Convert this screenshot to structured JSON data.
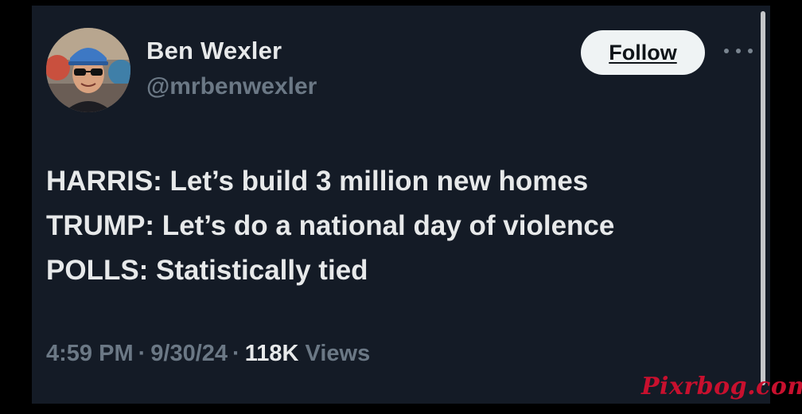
{
  "author": {
    "display_name": "Ben Wexler",
    "handle": "@mrbenwexler"
  },
  "actions": {
    "follow_label": "Follow",
    "more_icon": "more-horizontal-icon"
  },
  "tweet": {
    "lines": [
      "HARRIS: Let’s build 3 million new homes",
      "TRUMP: Let’s do a national day of violence",
      "POLLS: Statistically tied"
    ]
  },
  "meta": {
    "time": "4:59 PM",
    "separator": "·",
    "date": "9/30/24",
    "views_count": "118K",
    "views_label": "Views"
  },
  "watermark": "Pixrbog.com",
  "colors": {
    "card_background": "#141b26",
    "primary_text": "#e7e9ea",
    "secondary_text": "#6b7885",
    "follow_button_bg": "#eff3f4",
    "watermark": "#c8102e"
  }
}
